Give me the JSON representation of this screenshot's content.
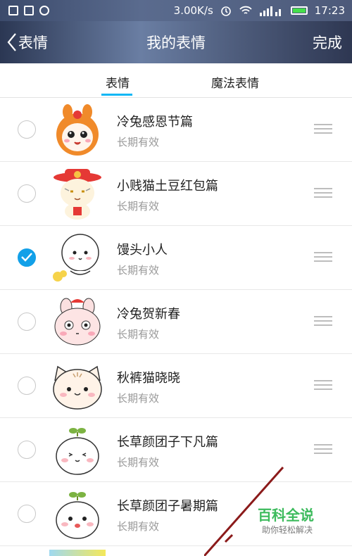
{
  "status_bar": {
    "speed": "3.00K/s",
    "time": "17:23",
    "icons": [
      "image-icon",
      "apps-icon",
      "clock-icon",
      "alarm-icon",
      "wifi-icon",
      "signal-icon",
      "battery-icon"
    ]
  },
  "header": {
    "back_label": "表情",
    "title": "我的表情",
    "done_label": "完成"
  },
  "tabs": [
    {
      "label": "表情",
      "active": true
    },
    {
      "label": "魔法表情",
      "active": false
    }
  ],
  "items": [
    {
      "name": "冷兔感恩节篇",
      "subtitle": "长期有效",
      "checked": false,
      "icon": "orange-bunny-sticker"
    },
    {
      "name": "小贱猫土豆红包篇",
      "subtitle": "长期有效",
      "checked": false,
      "icon": "cat-red-hat-sticker"
    },
    {
      "name": "馒头小人",
      "subtitle": "长期有效",
      "checked": true,
      "icon": "bun-person-sticker"
    },
    {
      "name": "冷兔贺新春",
      "subtitle": "长期有效",
      "checked": false,
      "icon": "pink-bunny-sticker"
    },
    {
      "name": "秋裤猫晓晓",
      "subtitle": "长期有效",
      "checked": false,
      "icon": "cat-face-sticker"
    },
    {
      "name": "长草颜团子下凡篇",
      "subtitle": "长期有效",
      "checked": false,
      "icon": "sprout-dumpling-sticker"
    },
    {
      "name": "长草颜团子暑期篇",
      "subtitle": "长期有效",
      "checked": false,
      "icon": "sprout-dumpling-sticker"
    }
  ],
  "watermark": {
    "title": "百科全说",
    "subtitle": "助你轻松解决"
  },
  "colors": {
    "accent": "#12b7f5",
    "checked": "#12a0e8",
    "watermark_green": "#3dbb5d"
  }
}
